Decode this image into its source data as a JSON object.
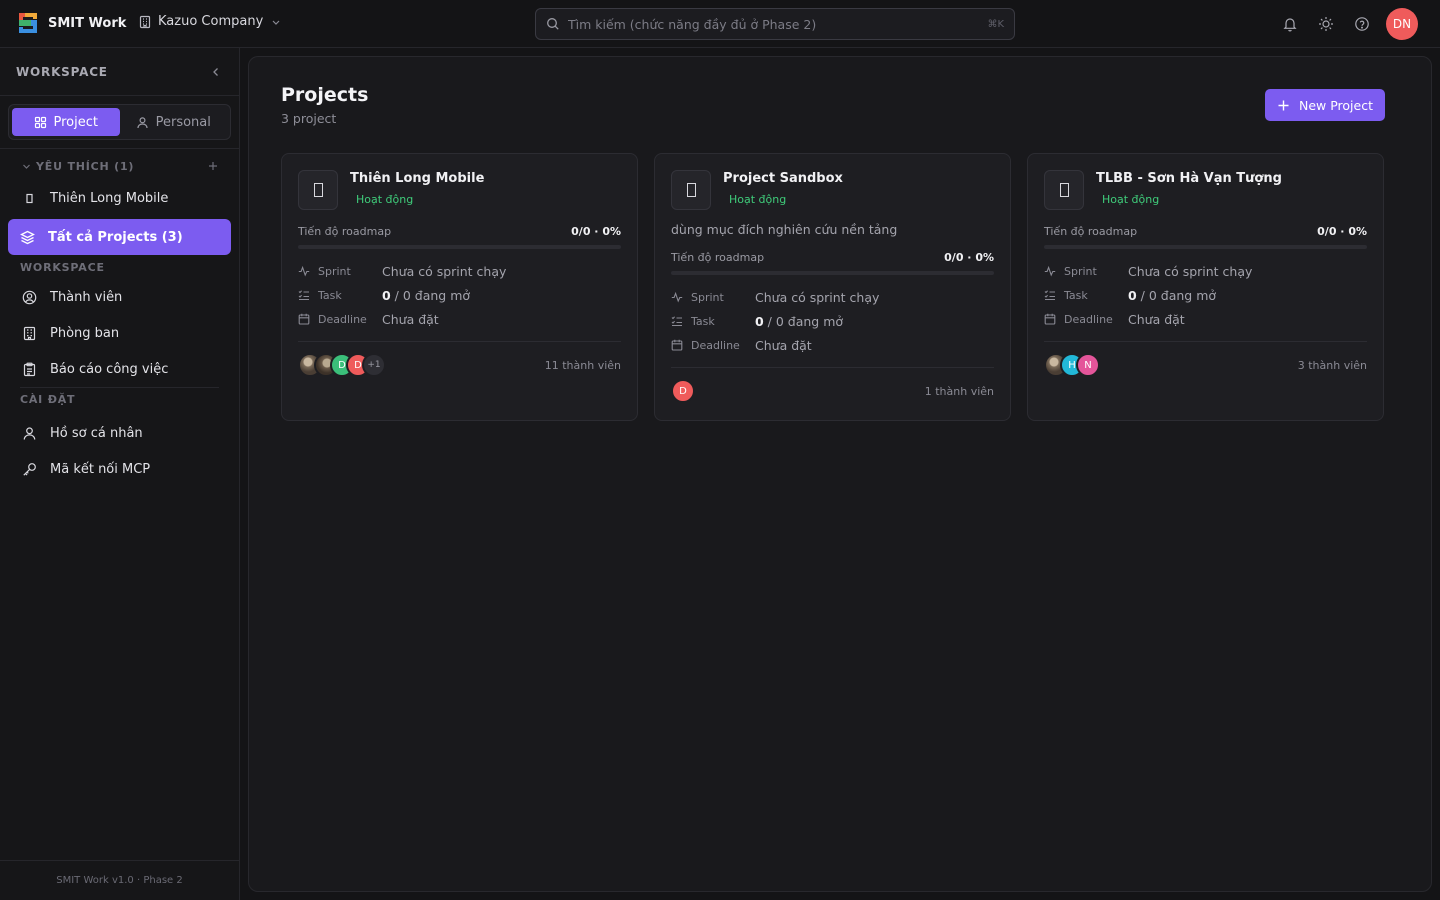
{
  "app": {
    "brand": "SMIT Work",
    "company": "Kazuo Company",
    "search_placeholder": "Tìm kiếm (chức năng đầy đủ ở Phase 2)",
    "search_shortcut": "⌘K",
    "user_initials": "DN",
    "accent": "#7c5cf0"
  },
  "sidebar": {
    "title": "WORKSPACE",
    "tabs": [
      {
        "label": "Project",
        "active": true
      },
      {
        "label": "Personal",
        "active": false
      }
    ],
    "favorites_label": "YÊU THÍCH (1)",
    "favorites": [
      {
        "label": "Thiên Long Mobile"
      }
    ],
    "all_projects": "Tất cả Projects (3)",
    "workspace_label": "WORKSPACE",
    "workspace_items": [
      {
        "label": "Thành viên",
        "icon": "user-circle-icon"
      },
      {
        "label": "Phòng ban",
        "icon": "building-icon"
      },
      {
        "label": "Báo cáo công việc",
        "icon": "clipboard-icon"
      }
    ],
    "settings_label": "CÀI ĐẶT",
    "settings_items": [
      {
        "label": "Hồ sơ cá nhân",
        "icon": "user-icon"
      },
      {
        "label": "Mã kết nối MCP",
        "icon": "key-icon"
      }
    ],
    "footer": "SMIT Work v1.0 · Phase 2"
  },
  "main": {
    "title": "Projects",
    "subtitle": "3 project",
    "new_button": "New Project",
    "labels": {
      "progress": "Tiến độ roadmap",
      "sprint": "Sprint",
      "task": "Task",
      "deadline": "Deadline"
    },
    "projects": [
      {
        "name": "Thiên Long Mobile",
        "status": "Hoạt động",
        "description": "",
        "progress_text": "0/0 · 0%",
        "progress": 0,
        "sprint": "Chưa có sprint chạy",
        "task_count": "0",
        "task_rest": " / 0 đang mở",
        "deadline": "Chưa đặt",
        "members": "11 thành viên",
        "avatars": [
          {
            "type": "photo"
          },
          {
            "type": "photo2"
          },
          {
            "type": "initial",
            "text": "D",
            "color": "#3bbf7a"
          },
          {
            "type": "initial",
            "text": "D",
            "color": "#ef5b5b"
          },
          {
            "type": "more",
            "text": "+1"
          }
        ]
      },
      {
        "name": "Project Sandbox",
        "status": "Hoạt động",
        "description": "dùng mục đích nghiên cứu nền tảng",
        "progress_text": "0/0 · 0%",
        "progress": 0,
        "sprint": "Chưa có sprint chạy",
        "task_count": "0",
        "task_rest": " / 0 đang mở",
        "deadline": "Chưa đặt",
        "members": "1 thành viên",
        "avatars": [
          {
            "type": "initial",
            "text": "D",
            "color": "#ef5b5b"
          }
        ]
      },
      {
        "name": "TLBB - Sơn Hà Vạn Tượng",
        "status": "Hoạt động",
        "description": "",
        "progress_text": "0/0 · 0%",
        "progress": 0,
        "sprint": "Chưa có sprint chạy",
        "task_count": "0",
        "task_rest": " / 0 đang mở",
        "deadline": "Chưa đặt",
        "members": "3 thành viên",
        "avatars": [
          {
            "type": "photo"
          },
          {
            "type": "initial",
            "text": "H",
            "color": "#22b8d8"
          },
          {
            "type": "initial",
            "text": "N",
            "color": "#e4559a"
          }
        ]
      }
    ]
  }
}
